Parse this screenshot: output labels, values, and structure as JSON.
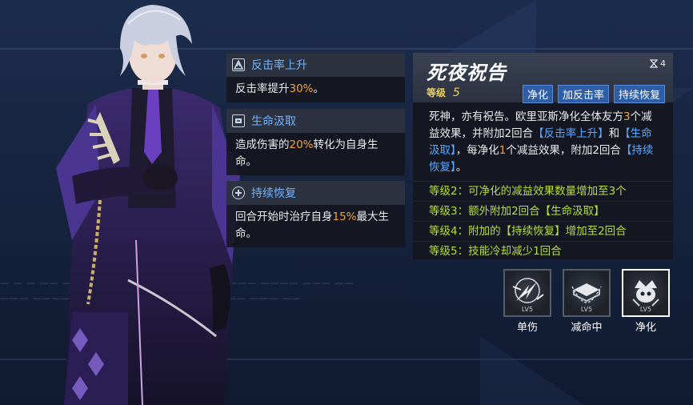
{
  "buffs": [
    {
      "icon": "counter-rate-icon",
      "title": "反击率上升",
      "body_parts": [
        [
          "反击率提升",
          ""
        ],
        [
          "30%",
          "hl"
        ],
        [
          "。",
          ""
        ]
      ]
    },
    {
      "icon": "lifesteal-icon",
      "title": "生命汲取",
      "body_parts": [
        [
          "造成伤害的",
          ""
        ],
        [
          "20%",
          "hl"
        ],
        [
          "转化为自身生命。",
          ""
        ]
      ]
    },
    {
      "icon": "regen-icon",
      "title": "持续恢复",
      "body_parts": [
        [
          "回合开始时治疗自身",
          ""
        ],
        [
          "15%",
          "hl"
        ],
        [
          "最大生命。",
          ""
        ]
      ]
    }
  ],
  "skill": {
    "name": "死夜祝告",
    "cooldown": "4",
    "level_label": "等级",
    "level": "5",
    "tags": [
      "净化",
      "加反击率",
      "持续恢复"
    ],
    "desc_parts": [
      [
        "死神，亦有祝告。欧里亚斯净化全体友方",
        ""
      ],
      [
        "3",
        "org"
      ],
      [
        "个减益效果，并附加2回合",
        ""
      ],
      [
        "【反击率上升】",
        "blue"
      ],
      [
        "和",
        ""
      ],
      [
        "【生命汲取】",
        "blue"
      ],
      [
        "，每净化",
        ""
      ],
      [
        "1",
        "org"
      ],
      [
        "个减益效果，附加2回合",
        ""
      ],
      [
        "【持续恢复】",
        "blue"
      ],
      [
        "。",
        ""
      ]
    ],
    "levels": [
      "等级2：可净化的减益效果数量增加至3个",
      "等级3：额外附加2回合【生命汲取】",
      "等级4：附加的【持续恢复】增加至2回合",
      "等级5：技能冷却减少1回合"
    ]
  },
  "skill_icons": [
    {
      "label": "单伤",
      "lv": "LV5",
      "icon": "lightning-slash-icon",
      "active": false
    },
    {
      "label": "减命中",
      "lv": "LV5",
      "icon": "book-chain-icon",
      "active": false
    },
    {
      "label": "净化",
      "lv": "LV5",
      "icon": "skull-crown-icon",
      "active": true
    }
  ],
  "colors": {
    "accent_blue": "#5aa8ff",
    "highlight_orange": "#f0a238",
    "level_green": "#b5de3a",
    "level_gold": "#f0d25a",
    "tag_bg": "#2f5ea8"
  }
}
